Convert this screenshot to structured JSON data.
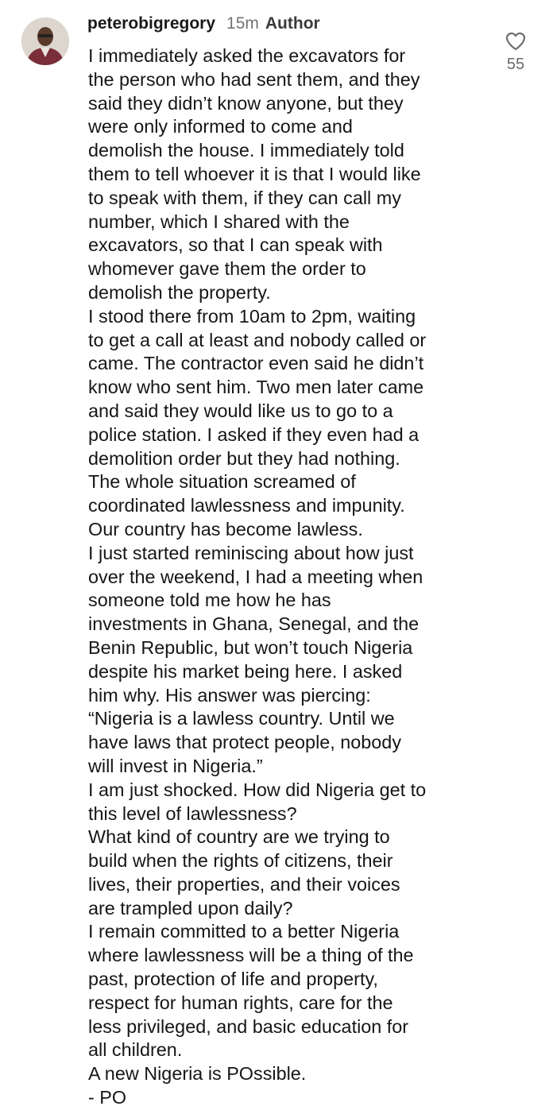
{
  "comment": {
    "username": "peterobigregory",
    "time": "15m",
    "author_badge": "Author",
    "avatar_icon": "profile-photo",
    "like_icon": "heart-outline-icon",
    "like_count": "55",
    "lines": [
      "I immediately asked the excavators for",
      "the person who had sent them, and they",
      "said they didn’t know anyone, but they",
      "were only informed to come and",
      "demolish the house. I immediately told",
      "them to tell whoever it is that I would like",
      "to speak with them, if they can call my",
      "number, which I shared with the",
      "excavators, so that I can speak with",
      "whomever gave them the order to",
      "demolish the property.",
      "I stood there from 10am to 2pm, waiting",
      "to get a call at least and nobody called or",
      "came. The contractor even said he didn’t",
      "know who sent him. Two men later came",
      "and said they would like us to go to a",
      "police station. I asked if they even had a",
      "demolition order but they had nothing.",
      "The whole situation screamed of",
      "coordinated lawlessness and impunity.",
      "Our country has become lawless.",
      "I just started reminiscing about how just",
      "over the weekend, I had a meeting when",
      "someone told me how he has",
      "investments in Ghana, Senegal, and the",
      "Benin Republic, but won’t touch Nigeria",
      "despite his market being here. I asked",
      "him why. His answer was piercing:",
      "“Nigeria is a lawless country. Until we",
      "have laws that protect people, nobody",
      "will invest in Nigeria.”",
      "I am just shocked. How did Nigeria get to",
      "this level of lawlessness?",
      "What kind of country are we trying to",
      "build when the rights of citizens, their",
      "lives, their properties, and their voices",
      "are trampled upon daily?",
      "I remain committed to a better Nigeria",
      "where lawlessness will be a thing of the",
      "past, protection of life and property,",
      "respect for human rights, care for the",
      "less privileged, and basic education for",
      "all children.",
      "A  new Nigeria is POssible.",
      "- PO"
    ]
  }
}
